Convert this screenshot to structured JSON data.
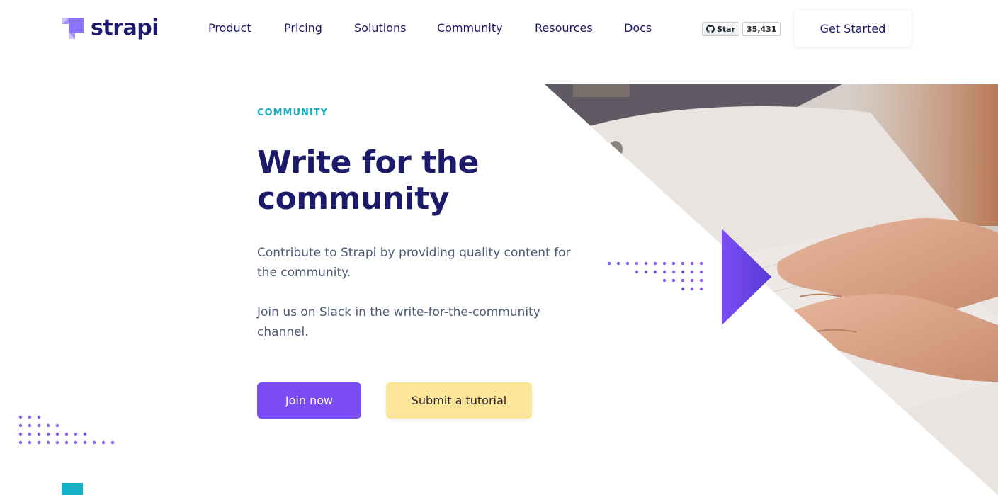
{
  "nav": {
    "logo_text": "strapi",
    "links": [
      "Product",
      "Pricing",
      "Solutions",
      "Community",
      "Resources",
      "Docs"
    ],
    "github": {
      "star_label": "Star",
      "count": "35,431"
    },
    "cta_label": "Get Started"
  },
  "hero": {
    "eyebrow": "COMMUNITY",
    "title_line1": "Write for the",
    "title_line2": "community",
    "paragraph1": "Contribute to Strapi by providing quality content for the community.",
    "paragraph2": "Join us on Slack in the write-for-the-community channel.",
    "primary_button": "Join now",
    "secondary_button": "Submit a tutorial"
  },
  "colors": {
    "brand_navy": "#1c1a6b",
    "brand_purple": "#7b4cf4",
    "accent_yellow": "#fde597",
    "accent_teal": "#14b1c7",
    "body_text": "#4e5a76"
  },
  "icons": [
    "strapi-logo-icon",
    "github-icon",
    "play-triangle-icon"
  ]
}
